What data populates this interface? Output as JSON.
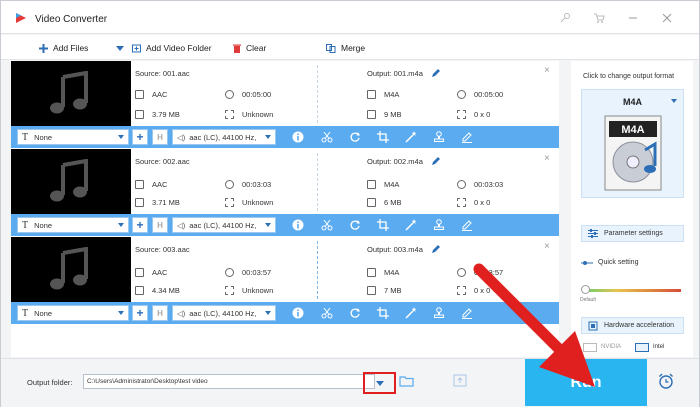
{
  "window": {
    "title": "Video Converter"
  },
  "toolbar": {
    "add_files": "Add Files",
    "add_video_folder": "Add Video Folder",
    "clear": "Clear",
    "merge": "Merge"
  },
  "items": [
    {
      "source": "Source: 001.aac",
      "output": "Output: 001.m4a",
      "src_format": "AAC",
      "src_duration": "00:05:00",
      "src_size": "3.79 MB",
      "src_resolution": "Unknown",
      "out_format": "M4A",
      "out_duration": "00:05:00",
      "out_size": "9 MB",
      "out_resolution": "0 x 0",
      "subtitle": "None",
      "audio": "aac (LC), 44100 Hz,"
    },
    {
      "source": "Source: 002.aac",
      "output": "Output: 002.m4a",
      "src_format": "AAC",
      "src_duration": "00:03:03",
      "src_size": "3.71 MB",
      "src_resolution": "Unknown",
      "out_format": "M4A",
      "out_duration": "00:03:03",
      "out_size": "6 MB",
      "out_resolution": "0 x 0",
      "subtitle": "None",
      "audio": "aac (LC), 44100 Hz,"
    },
    {
      "source": "Source: 003.aac",
      "output": "Output: 003.m4a",
      "src_format": "AAC",
      "src_duration": "00:03:57",
      "src_size": "4.34 MB",
      "src_resolution": "Unknown",
      "out_format": "M4A",
      "out_duration": "00:03:57",
      "out_size": "7 MB",
      "out_resolution": "0 x 0",
      "subtitle": "None",
      "audio": "aac (LC), 44100 Hz,"
    }
  ],
  "right_panel": {
    "hint": "Click to change output format",
    "format": "M4A",
    "format_badge": "M4A",
    "parameter_settings": "Parameter settings",
    "quick_setting": "Quick setting",
    "default_label": "Default",
    "hardware_acceleration": "Hardware acceleration",
    "nvidia": "NVIDIA",
    "intel": "Intel"
  },
  "bottom": {
    "output_folder_label": "Output folder:",
    "output_folder_value": "C:\\Users\\Administrator\\Desktop\\test video",
    "run": "Run"
  },
  "colors": {
    "accent": "#29b5ef",
    "bar": "#5aabf0",
    "highlight": "#e01f1f"
  }
}
